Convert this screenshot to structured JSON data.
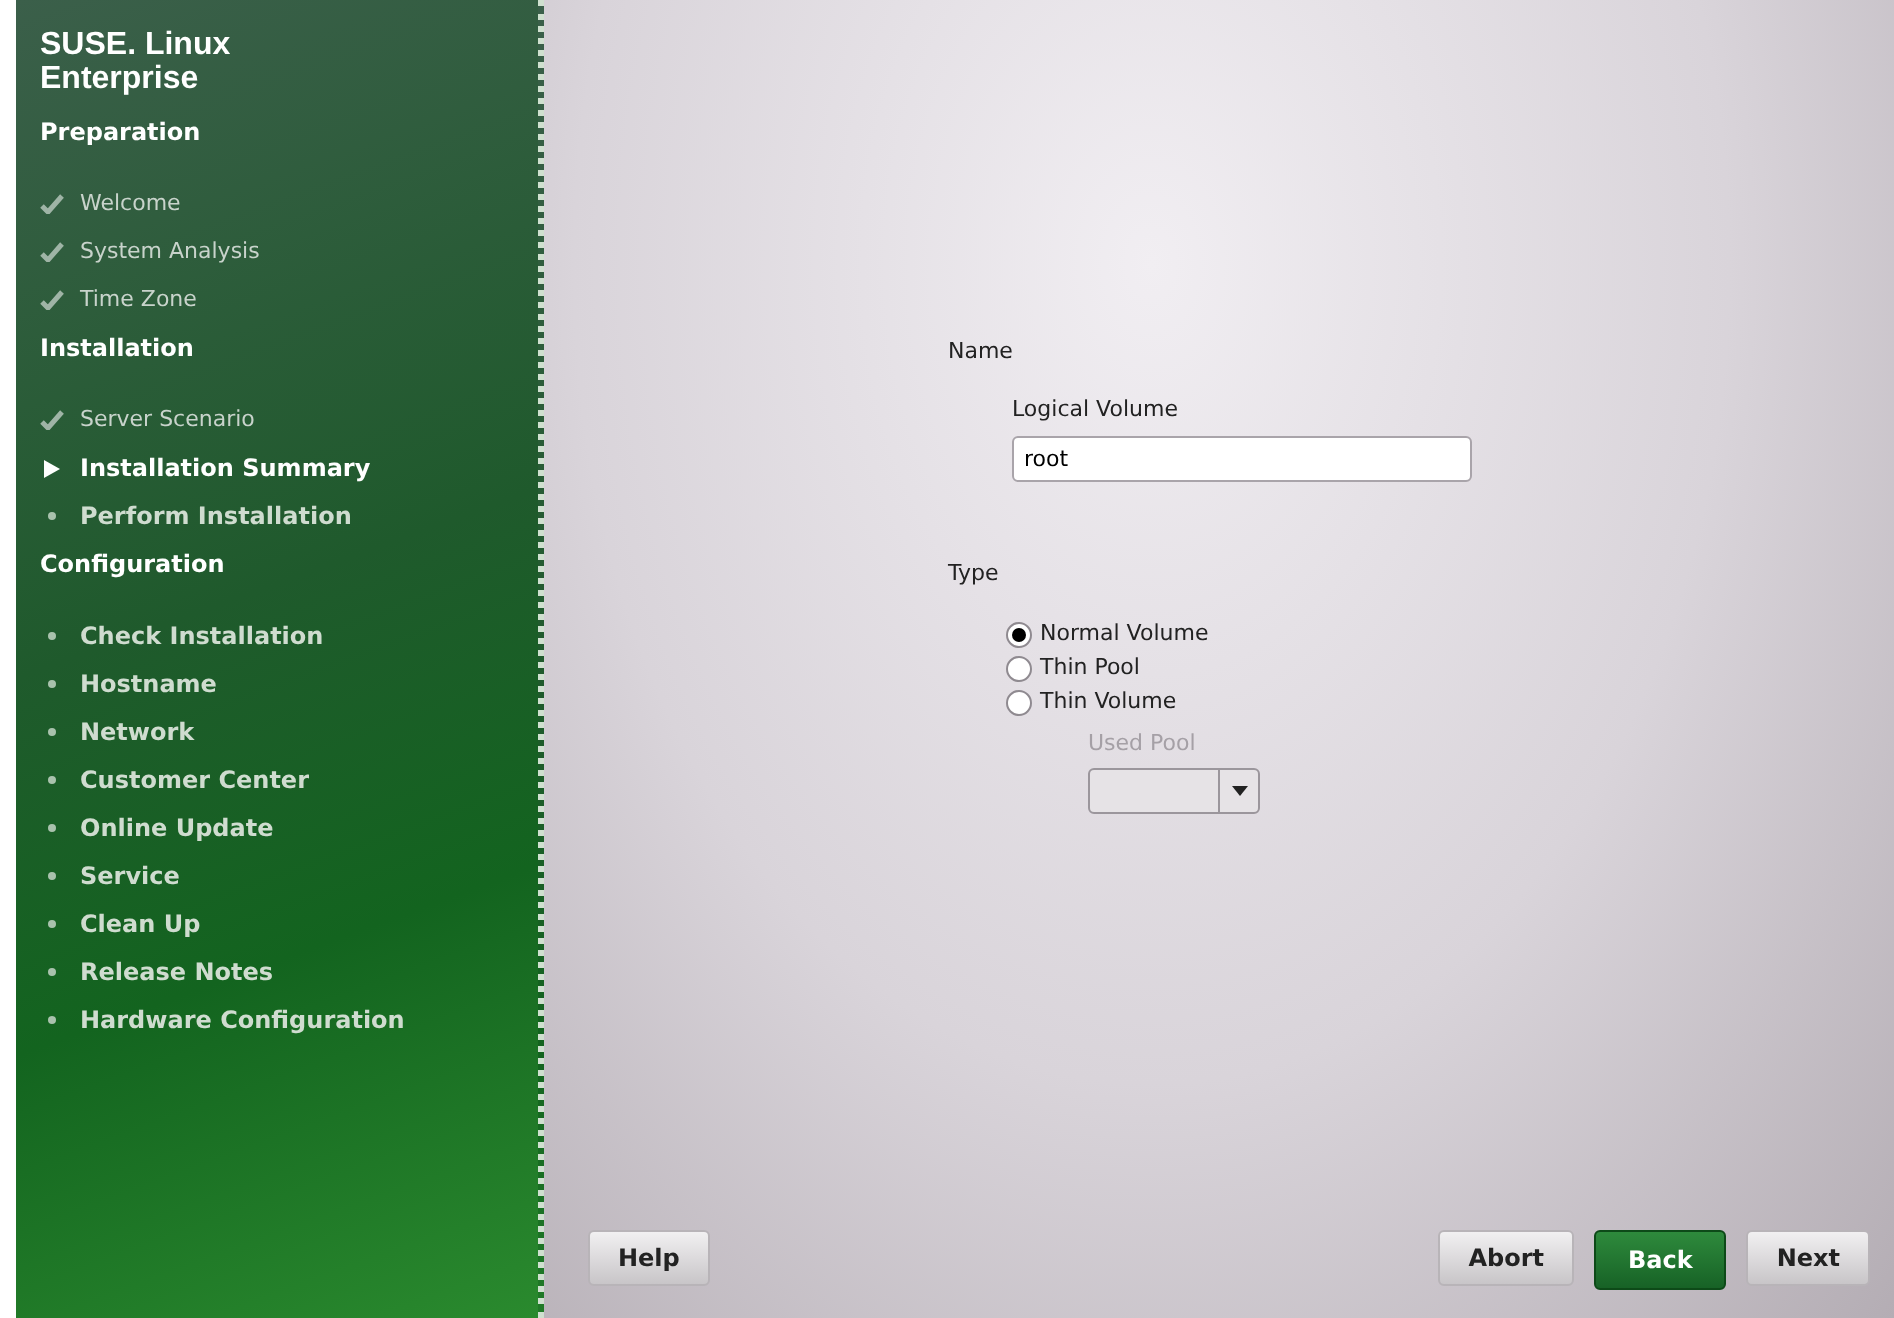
{
  "sidebar": {
    "product": "SUSE. Linux",
    "product_line2": "Enterprise",
    "sections": [
      {
        "title": "Preparation",
        "steps": [
          {
            "label": "Welcome",
            "kind": "done"
          },
          {
            "label": "System Analysis",
            "kind": "done"
          },
          {
            "label": "Time Zone",
            "kind": "done"
          }
        ]
      },
      {
        "title": "Installation",
        "steps": [
          {
            "label": "Server Scenario",
            "kind": "done"
          },
          {
            "label": "Installation Summary",
            "kind": "current"
          },
          {
            "label": "Perform Installation",
            "kind": "pending"
          }
        ]
      },
      {
        "title": "Configuration",
        "steps": [
          {
            "label": "Check Installation",
            "kind": "pending"
          },
          {
            "label": "Hostname",
            "kind": "pending"
          },
          {
            "label": "Network",
            "kind": "pending"
          },
          {
            "label": "Customer Center",
            "kind": "pending"
          },
          {
            "label": "Online Update",
            "kind": "pending"
          },
          {
            "label": "Service",
            "kind": "pending"
          },
          {
            "label": "Clean Up",
            "kind": "pending"
          },
          {
            "label": "Release Notes",
            "kind": "pending"
          },
          {
            "label": "Hardware Configuration",
            "kind": "pending"
          }
        ]
      }
    ]
  },
  "form": {
    "name_heading": "Name",
    "lv_label": "Logical Volume",
    "lv_value": "root",
    "type_heading": "Type",
    "types": [
      {
        "label": "Normal Volume",
        "selected": true
      },
      {
        "label": "Thin Pool",
        "selected": false
      },
      {
        "label": "Thin Volume",
        "selected": false
      }
    ],
    "used_pool": {
      "label": "Used Pool",
      "disabled": true
    }
  },
  "buttons": [
    {
      "label": "Help",
      "kind": "left",
      "default": false
    },
    {
      "label": "Abort",
      "kind": "right",
      "default": false
    },
    {
      "label": "Back",
      "kind": "right",
      "default": true
    },
    {
      "label": "Next",
      "kind": "right",
      "default": false
    }
  ]
}
